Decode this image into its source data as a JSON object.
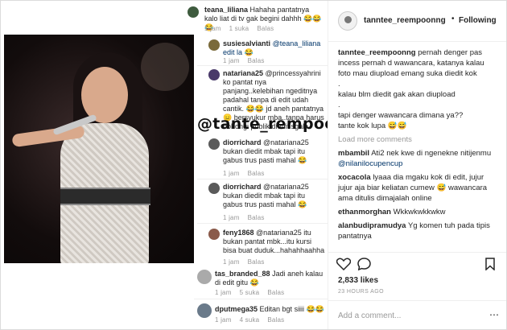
{
  "left": {
    "comments": [
      {
        "user": "teana_liliana",
        "text": "Hahaha pantatnya kalo liat di tv gak begini dahhh 😂😂😂",
        "meta": [
          "1 jam",
          "1 suka",
          "Balas"
        ]
      },
      {
        "user": "susiesalvianti",
        "text": "@teana_liliana edit la",
        "emoji": "😂",
        "meta": [
          "1 jam",
          "Balas"
        ]
      },
      {
        "user": "natariana25",
        "text": "@princessyahrini ko pantat nya panjang..kelebihan ngeditnya padahal tanpa di edit udah cantik.",
        "emoji": "😂😂",
        "text2": "jd aneh pantatnya",
        "text3": "bersyukur mba..tanpa harus bohongi publik diedit sgala"
      },
      {
        "user": "diorrichard",
        "text": "@natariana25 bukan diedit mbak tapi itu gabus trus pasti mahal",
        "emoji": "😂",
        "meta": [
          "1 jam",
          "Balas"
        ]
      },
      {
        "user": "diorrichard",
        "text": "@natariana25 bukan diedit mbak tapi itu gabus trus pasti mahal",
        "emoji": "😂",
        "meta": [
          "1 jam",
          "Balas"
        ]
      },
      {
        "user": "feny1868",
        "text": "@natariana25 itu bukan pantat mbk...itu kursi bisa buat duduk...hahahhaahha",
        "meta": [
          "1 jam",
          "Balas"
        ]
      },
      {
        "user": "tas_branded_88",
        "text": "Jadi aneh kalau di edit gitu",
        "emoji": "😂",
        "meta": [
          "1 jam",
          "5 suka",
          "Balas"
        ]
      },
      {
        "user": "dputmega35",
        "text": "Editan bgt siiii",
        "emoji": "😂😂",
        "meta": [
          "1 jam",
          "4 suka",
          "Balas"
        ]
      }
    ],
    "watermark": "@tante_rempoong"
  },
  "post": {
    "username": "tanntee_reempoonng",
    "follow_label": "Following",
    "caption_user": "tanntee_reempoonng",
    "caption_lines": [
      "pernah denger pas incess pernah d wawancara, katanya kalau foto mau diupload emang suka diedit kok",
      ".",
      "kalau blm diedit gak akan diupload",
      ".",
      "tapi denger wawancara dimana ya??",
      "tante kok lupa"
    ],
    "caption_emoji": "😅😅",
    "load_more": "Load more comments",
    "comments": [
      {
        "user": "mbambil",
        "text": "Ati2 nek kwe di ngeneknе nitijenmu",
        "mention": "@nilanilocupencup"
      },
      {
        "user": "xocacola",
        "text": "lyaaa dia mgaku kok di edit, jujur jujur aja biar keliatan cumew",
        "emoji": "😅",
        "text2": "wawancara ama ditulis dimajalah online"
      },
      {
        "user": "ethanmorghan",
        "text": "Wkkwkwkkwkw"
      },
      {
        "user": "alanbudipramudya",
        "text": "Yg komen tuh pada tipis pantatnya"
      }
    ],
    "likes": "2,833 likes",
    "time": "23 HOURS AGO",
    "add_comment_placeholder": "Add a comment...",
    "more_icon": "ellipsis-icon"
  }
}
